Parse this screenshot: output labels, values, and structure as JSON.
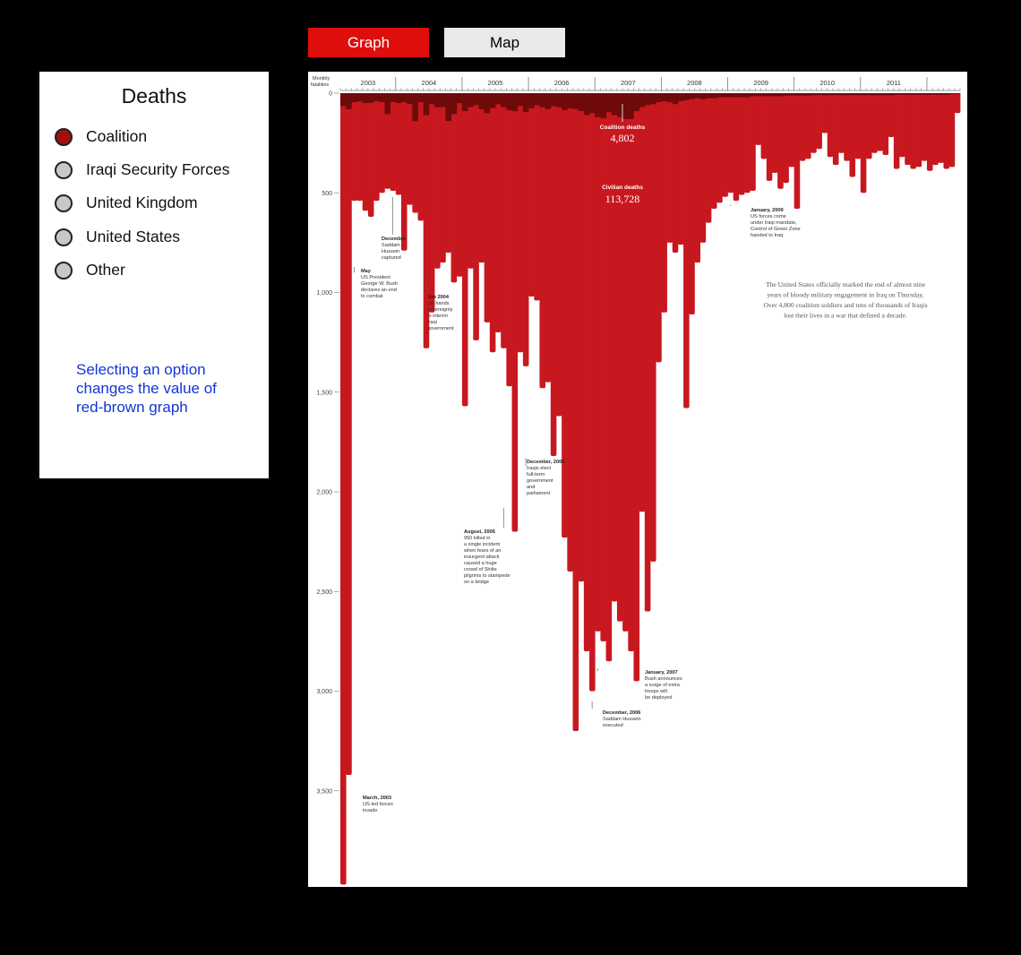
{
  "tabs": {
    "graph": "Graph",
    "map": "Map"
  },
  "panel": {
    "title": "Deaths",
    "options": [
      {
        "label": "Coalition",
        "selected": true
      },
      {
        "label": "Iraqi Security Forces",
        "selected": false
      },
      {
        "label": "United Kingdom",
        "selected": false
      },
      {
        "label": "United States",
        "selected": false
      },
      {
        "label": "Other",
        "selected": false
      }
    ],
    "note": "Selecting an option changes the value of red-brown graph"
  },
  "colors": {
    "civilian": "#c8181f",
    "coalition": "#6e0a0a",
    "selected_radio": "#a00f0f",
    "tab_active": "#e00d0d"
  },
  "chart_data": {
    "type": "bar",
    "orientation": "downward",
    "ylabel": "Monthly fatalities",
    "ylim": [
      0,
      4000
    ],
    "y_ticks": [
      0,
      500,
      1000,
      1500,
      2000,
      2500,
      3000,
      3500
    ],
    "y_tick_labels": [
      "0",
      "500",
      "1,000",
      "1,500",
      "2,000",
      "2,500",
      "3,000",
      "3,500"
    ],
    "year_labels": [
      "2003",
      "2004",
      "2005",
      "2006",
      "2007",
      "2008",
      "2009",
      "2010",
      "2011"
    ],
    "x_start": "2003-03",
    "series": [
      {
        "name": "Civilian deaths",
        "total": "113,728",
        "values": [
          3970,
          3420,
          540,
          540,
          590,
          620,
          540,
          500,
          480,
          490,
          510,
          790,
          560,
          600,
          640,
          1280,
          1100,
          880,
          850,
          800,
          950,
          920,
          1570,
          880,
          1240,
          850,
          1150,
          1300,
          1200,
          1280,
          1470,
          2200,
          1300,
          1370,
          1020,
          1040,
          1480,
          1450,
          1820,
          1620,
          2230,
          2400,
          3200,
          2450,
          2800,
          3000,
          2700,
          2750,
          2850,
          2550,
          2650,
          2700,
          2800,
          2950,
          2100,
          2600,
          2350,
          1350,
          1100,
          750,
          800,
          760,
          1580,
          1110,
          850,
          750,
          650,
          580,
          550,
          520,
          500,
          540,
          510,
          500,
          490,
          260,
          330,
          440,
          400,
          480,
          450,
          370,
          580,
          340,
          330,
          300,
          280,
          200,
          320,
          360,
          300,
          340,
          420,
          330,
          500,
          330,
          300,
          290,
          310,
          220,
          380,
          320,
          360,
          380,
          370,
          340,
          390,
          360,
          350,
          380,
          370,
          100
        ]
      },
      {
        "name": "Coalition deaths",
        "total": "4,802",
        "values": [
          65,
          80,
          45,
          40,
          50,
          48,
          40,
          45,
          105,
          45,
          50,
          45,
          55,
          140,
          45,
          110,
          55,
          70,
          70,
          140,
          105,
          50,
          90,
          70,
          60,
          80,
          100,
          75,
          55,
          70,
          85,
          90,
          65,
          95,
          75,
          60,
          70,
          80,
          65,
          70,
          85,
          75,
          80,
          90,
          110,
          100,
          120,
          125,
          95,
          110,
          120,
          130,
          130,
          90,
          70,
          60,
          55,
          45,
          40,
          45,
          55,
          40,
          35,
          30,
          25,
          30,
          25,
          25,
          20,
          20,
          20,
          20,
          20,
          20,
          15,
          15,
          15,
          15,
          15,
          15,
          12,
          12,
          12,
          12,
          12,
          10,
          10,
          10,
          10,
          10,
          10,
          10,
          10,
          10,
          10,
          10,
          10,
          10,
          10,
          10,
          8,
          8,
          8,
          8,
          8,
          8,
          8,
          8,
          8,
          8,
          5,
          5
        ]
      }
    ],
    "annotations": [
      {
        "month": 0,
        "date": "March, 2003",
        "text": [
          "US-led forces",
          "invade"
        ]
      },
      {
        "month": 2,
        "date": "May",
        "text": [
          "US President",
          "George W. Bush",
          "declares an end",
          "to combat"
        ]
      },
      {
        "month": 9,
        "date": "December",
        "text": [
          "Saddam",
          "Hussein",
          "captured"
        ]
      },
      {
        "month": 15,
        "date": "Jun 2004",
        "text": [
          "US hands",
          "sovereignty",
          "to interim",
          "Iraqi",
          "government"
        ]
      },
      {
        "month": 29,
        "date": "August, 2005",
        "text": [
          "950 killed in",
          "a single incident",
          "when fears of an",
          "insurgent attack",
          "caused a huge",
          "crowd of Shiite",
          "pilgrims to stampede",
          "on a bridge"
        ]
      },
      {
        "month": 33,
        "date": "December, 2005",
        "text": [
          "Iraqis elect",
          "full-term",
          "government",
          "and",
          "parliament"
        ]
      },
      {
        "month": 45,
        "date": "December, 2006",
        "text": [
          "Saddam Hussein",
          "executed"
        ]
      },
      {
        "month": 46,
        "date": "January, 2007",
        "text": [
          "Bush announces",
          "a surge of extra",
          "troops will",
          "be deployed"
        ]
      },
      {
        "month": 70,
        "date": "January, 2009",
        "text": [
          "US forces come",
          "under Iraqi mandate,",
          "Control of Green Zone",
          "handed to Iraq"
        ]
      }
    ],
    "summary": [
      "The United States officially marked the end of almost nine",
      "years of bloody military engagement in Iraq on Thursday.",
      "Over 4,800 coalition soldiers and tens of thousands of Iraqis",
      "lost their lives in a war that defined a decade."
    ]
  }
}
